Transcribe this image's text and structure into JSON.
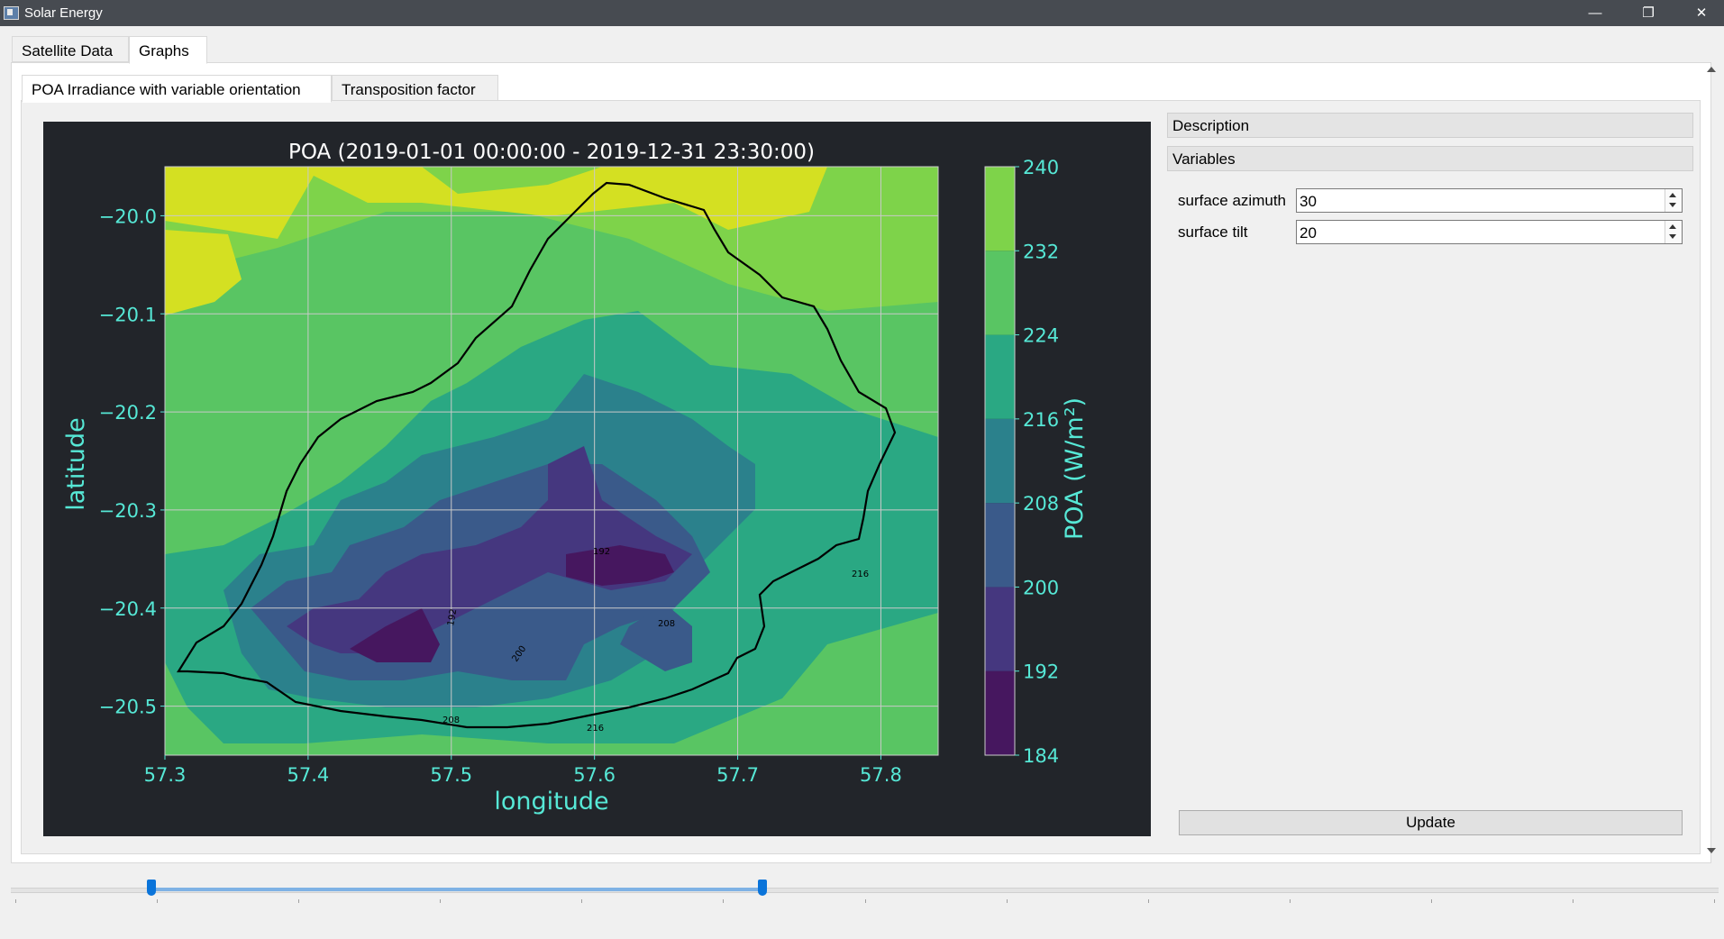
{
  "window": {
    "title": "Solar Energy",
    "controls": [
      "minimize-icon",
      "restore-icon",
      "close-icon"
    ]
  },
  "main_tabs": [
    {
      "label": "Satellite Data",
      "active": false
    },
    {
      "label": "Graphs",
      "active": true
    }
  ],
  "graph_tabs": [
    {
      "label": "POA Irradiance with variable orientation",
      "active": true
    },
    {
      "label": "Transposition factor",
      "active": false
    }
  ],
  "side_panel": {
    "description_header": "Description",
    "variables_header": "Variables",
    "variables": [
      {
        "label": "surface azimuth",
        "value": "30"
      },
      {
        "label": "surface tilt",
        "value": "20"
      }
    ],
    "update_label": "Update"
  },
  "range_slider": {
    "lower_fraction": 0.08,
    "upper_fraction": 0.44,
    "tick_count": 13
  },
  "chart_data": {
    "type": "heatmap",
    "subtype": "filled contour map",
    "title": "POA (2019-01-01 00:00:00 - 2019-12-31 23:30:00)",
    "xlabel": "longitude",
    "ylabel": "latitude",
    "xlim": [
      57.3,
      57.84
    ],
    "ylim": [
      -20.55,
      -19.95
    ],
    "x_ticks": [
      "57.3",
      "57.4",
      "57.5",
      "57.6",
      "57.7",
      "57.8"
    ],
    "x_tick_values": [
      57.3,
      57.4,
      57.5,
      57.6,
      57.7,
      57.8
    ],
    "y_ticks": [
      "−20.0",
      "−20.1",
      "−20.2",
      "−20.3",
      "−20.4",
      "−20.5"
    ],
    "y_tick_values": [
      -20.0,
      -20.1,
      -20.2,
      -20.3,
      -20.4,
      -20.5
    ],
    "grid": true,
    "colorbar": {
      "label": "POA (W/m²)",
      "levels": [
        184,
        192,
        200,
        208,
        216,
        224,
        232,
        240
      ],
      "tick_labels": [
        "184",
        "192",
        "200",
        "208",
        "216",
        "224",
        "232",
        "240"
      ],
      "colors": [
        "#46175f",
        "#45377f",
        "#3a5a8a",
        "#2b818c",
        "#2aa883",
        "#59c563",
        "#7ed34a",
        "#d4e022"
      ]
    },
    "contour_labels": [
      "192",
      "192",
      "200",
      "208",
      "208",
      "216",
      "216"
    ],
    "colors": {
      "background": "#22252a",
      "text": "#56e8d6",
      "coastline": "#000000",
      "grid": "#c9c9c9"
    }
  }
}
